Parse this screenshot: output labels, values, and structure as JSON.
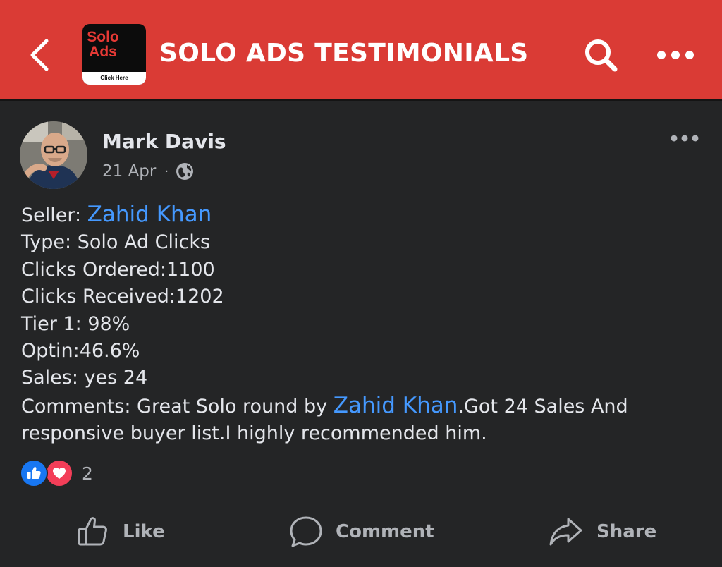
{
  "header": {
    "title": "SOLO ADS TESTIMONIALS",
    "logo": {
      "line1": "Solo",
      "line2": "Ads",
      "strip": "Click Here"
    },
    "back_icon": "chevron-left-icon",
    "search_icon": "search-icon",
    "menu_icon": "more-horizontal-icon"
  },
  "post": {
    "author": "Mark Davis",
    "date": "21 Apr",
    "separator": "·",
    "privacy_icon": "globe-icon",
    "lines": {
      "seller_prefix": "Seller: ",
      "seller_name": "Zahid Khan",
      "type": "Type: Solo Ad Clicks",
      "clicks_ordered": "Clicks Ordered:1100",
      "clicks_received": "Clicks Received:1202",
      "tier1": "Tier 1: 98%",
      "optin": "Optin:46.6%",
      "sales": "Sales: yes 24",
      "comments_prefix": "Comments: Great Solo round by ",
      "comments_mention": "Zahid Khan",
      "comments_suffix": ".Got 24 Sales And",
      "comments_line2": "responsive buyer list.I highly recommended him."
    },
    "reactions": {
      "count": "2",
      "types": [
        "like-icon",
        "love-icon"
      ]
    }
  },
  "actions": {
    "like": "Like",
    "comment": "Comment",
    "share": "Share"
  },
  "colors": {
    "header_bg": "#da3b35",
    "page_bg": "#242526",
    "text": "#e4e6eb",
    "muted": "#b0b3b8",
    "link": "#4599ff",
    "like_blue": "#1877f2",
    "love_red": "#f33e58"
  }
}
